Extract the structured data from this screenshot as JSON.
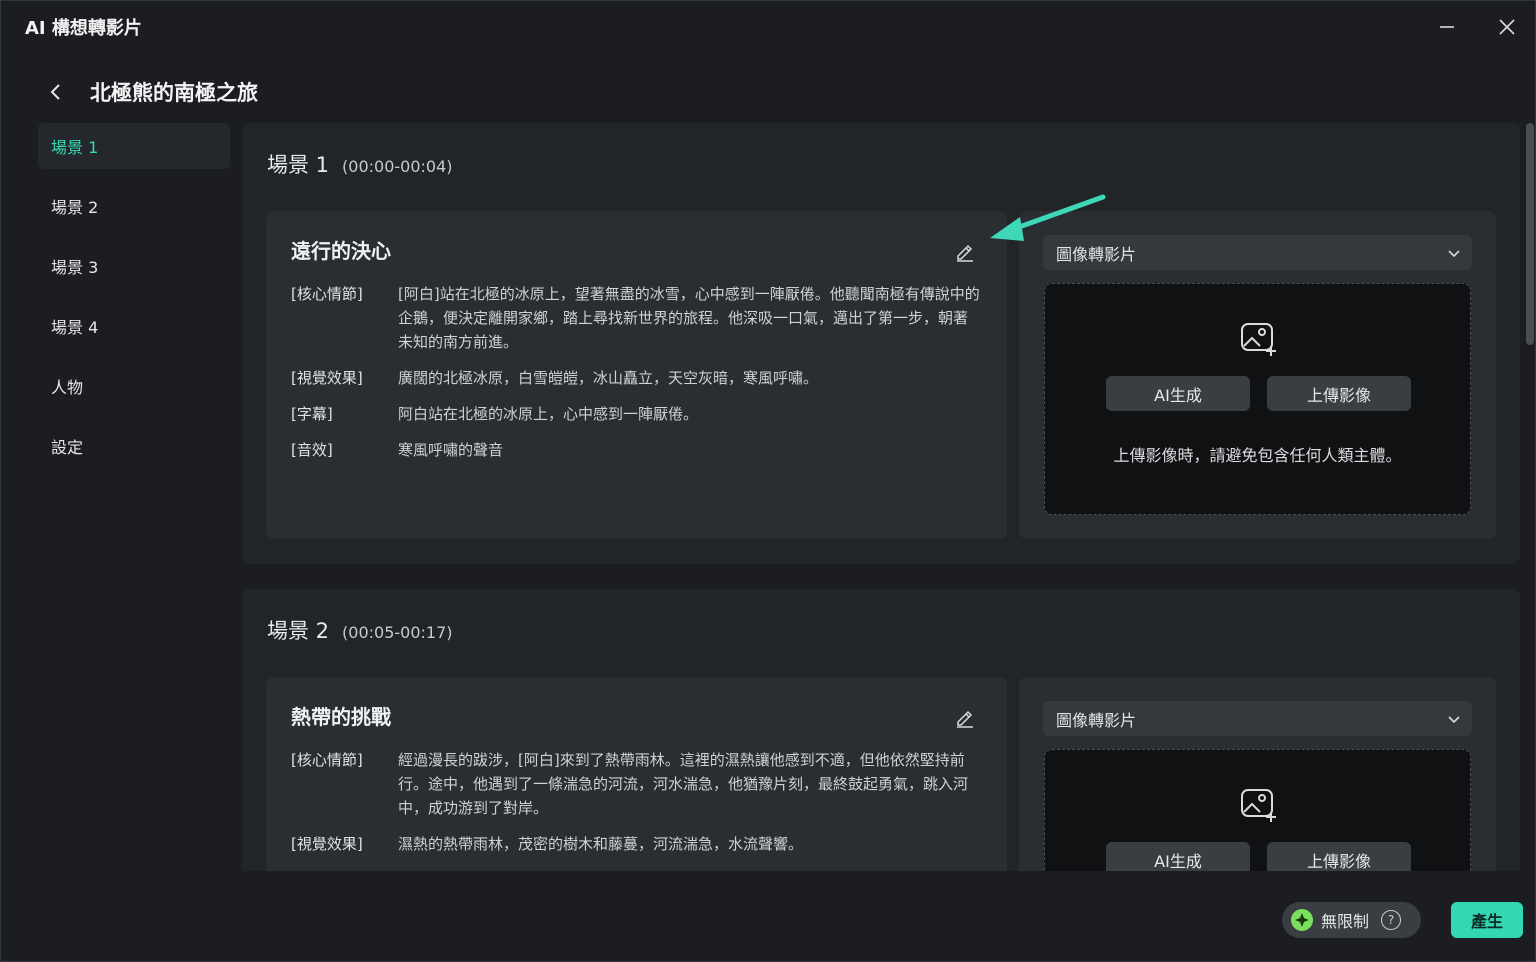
{
  "window": {
    "title": "AI 構想轉影片"
  },
  "header": {
    "project_title": "北極熊的南極之旅"
  },
  "sidebar": {
    "items": [
      {
        "label": "場景 1"
      },
      {
        "label": "場景 2"
      },
      {
        "label": "場景 3"
      },
      {
        "label": "場景 4"
      },
      {
        "label": "人物"
      },
      {
        "label": "設定"
      }
    ]
  },
  "scenes": [
    {
      "name": "場景 1",
      "time": "(00:00-00:04)",
      "story_title": "遠行的決心",
      "rows": [
        {
          "key": "[核心情節]",
          "value": "[阿白]站在北極的冰原上，望著無盡的冰雪，心中感到一陣厭倦。他聽聞南極有傳說中的企鵝，便決定離開家鄉，踏上尋找新世界的旅程。他深吸一口氣，邁出了第一步，朝著未知的南方前進。"
        },
        {
          "key": "[視覺效果]",
          "value": "廣闊的北極冰原，白雪皚皚，冰山矗立，天空灰暗，寒風呼嘯。"
        },
        {
          "key": "[字幕]",
          "value": "阿白站在北極的冰原上，心中感到一陣厭倦。"
        },
        {
          "key": "[音效]",
          "value": "寒風呼嘯的聲音"
        }
      ],
      "mode": "圖像轉影片",
      "ai_button": "AI生成",
      "upload_button": "上傳影像",
      "hint": "上傳影像時，請避免包含任何人類主體。"
    },
    {
      "name": "場景 2",
      "time": "(00:05-00:17)",
      "story_title": "熱帶的挑戰",
      "rows": [
        {
          "key": "[核心情節]",
          "value": "經過漫長的跋涉，[阿白]來到了熱帶雨林。這裡的濕熱讓他感到不適，但他依然堅持前行。途中，他遇到了一條湍急的河流，河水湍急，他猶豫片刻，最終鼓起勇氣，跳入河中，成功游到了對岸。"
        },
        {
          "key": "[視覺效果]",
          "value": "濕熱的熱帶雨林，茂密的樹木和藤蔓，河流湍急，水流聲響。"
        }
      ],
      "mode": "圖像轉影片",
      "ai_button": "AI生成",
      "upload_button": "上傳影像"
    }
  ],
  "footer": {
    "badge_label": "無限制",
    "help_glyph": "?",
    "generate_label": "產生"
  },
  "colors": {
    "accent": "#33d8b3",
    "background": "#1b1d20",
    "card": "#2a2d31"
  }
}
